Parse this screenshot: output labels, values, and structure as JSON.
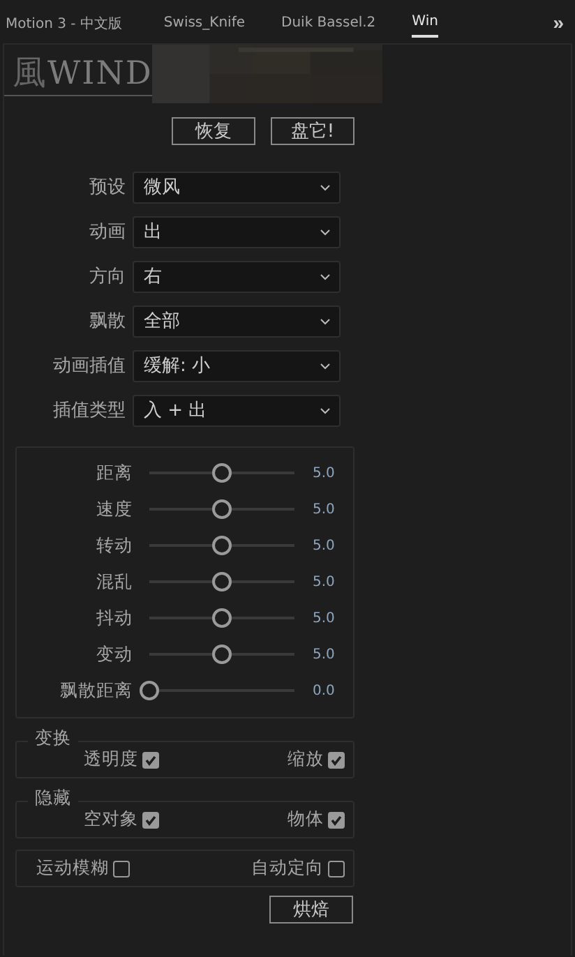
{
  "tabs": [
    {
      "label": "Motion 3 - 中文版",
      "selected": false
    },
    {
      "label": "Swiss_Knife",
      "selected": false
    },
    {
      "label": "Duik Bassel.2",
      "selected": false
    },
    {
      "label": "Win",
      "selected": true
    }
  ],
  "tabs_overflow": "»",
  "logo": {
    "glyph": "風",
    "text": "WIND"
  },
  "banner": {
    "kind": "picture"
  },
  "buttons": [
    "恢复",
    "盘它!"
  ],
  "dropdowns": [
    {
      "label": "预设",
      "value": "微风"
    },
    {
      "label": "动画",
      "value": "出"
    },
    {
      "label": "方向",
      "value": "右"
    },
    {
      "label": "飘散",
      "value": "全部"
    },
    {
      "label": "动画插值",
      "value": "缓解: 小"
    },
    {
      "label": "插值类型",
      "value": "入 + 出"
    }
  ],
  "sliders": [
    {
      "label": "距离",
      "level": 0.5,
      "reading": "5.0"
    },
    {
      "label": "速度",
      "level": 0.5,
      "reading": "5.0"
    },
    {
      "label": "转动",
      "level": 0.5,
      "reading": "5.0"
    },
    {
      "label": "混乱",
      "level": 0.5,
      "reading": "5.0"
    },
    {
      "label": "抖动",
      "level": 0.5,
      "reading": "5.0"
    },
    {
      "label": "变动",
      "level": 0.5,
      "reading": "5.0"
    },
    {
      "label": "飘散距离",
      "level": 0,
      "reading": "0.0"
    }
  ],
  "groups": [
    {
      "title": "变换",
      "options": [
        {
          "label": "透明度",
          "checked": true
        },
        {
          "label": "缩放",
          "checked": true
        }
      ]
    },
    {
      "title": "隐藏",
      "options": [
        {
          "label": "空对象",
          "checked": true
        },
        {
          "label": "物体",
          "checked": true
        }
      ]
    },
    {
      "options": [
        {
          "label": "运动模糊",
          "checked": false
        },
        {
          "label": "自动定向",
          "checked": false
        }
      ]
    }
  ],
  "bake_button": "烘焙"
}
